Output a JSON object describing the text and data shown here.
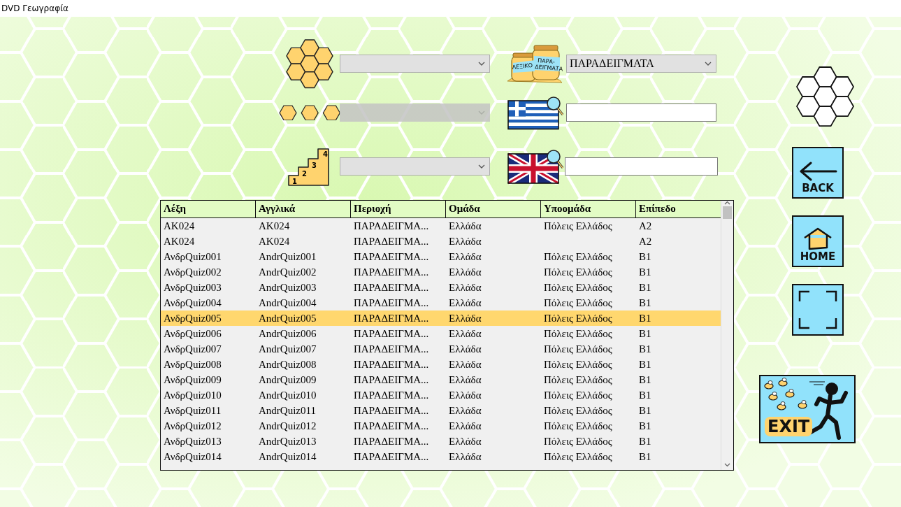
{
  "window": {
    "title": "DVD Γεωγραφία"
  },
  "left_filters": [
    {
      "kind": "groups",
      "disabled": false
    },
    {
      "kind": "subgroups",
      "disabled": true
    },
    {
      "kind": "levels",
      "disabled": false,
      "steps": [
        "1",
        "2",
        "3",
        "4"
      ]
    }
  ],
  "right_filters": [
    {
      "kind": "dictionary",
      "value": "ΠΑΡΑΔΕΙΓΜΑΤΑ",
      "jar_labels": [
        "ΛΕΞΙΚΟ",
        "ΠΑΡΑ-",
        "ΔΕΙΓΜΑΤΑ"
      ]
    },
    {
      "kind": "greek"
    },
    {
      "kind": "english"
    }
  ],
  "table": {
    "columns": [
      "Λέξη",
      "Αγγλικά",
      "Περιοχή",
      "Ομάδα",
      "Υποομάδα",
      "Επίπεδο"
    ],
    "rows": [
      {
        "selected": false,
        "cells": [
          "AK024",
          "AK024",
          "ΠΑΡΑΔΕΙΓΜΑ...",
          "Ελλάδα",
          "Πόλεις Ελλάδος",
          "A2"
        ]
      },
      {
        "selected": false,
        "cells": [
          "AK024",
          "AK024",
          "ΠΑΡΑΔΕΙΓΜΑ...",
          "Ελλάδα",
          null,
          "A2"
        ]
      },
      {
        "selected": false,
        "cells": [
          "ΑνδρQuiz001",
          "AndrQuiz001",
          "ΠΑΡΑΔΕΙΓΜΑ...",
          "Ελλάδα",
          "Πόλεις Ελλάδος",
          "B1"
        ]
      },
      {
        "selected": false,
        "cells": [
          "ΑνδρQuiz002",
          "AndrQuiz002",
          "ΠΑΡΑΔΕΙΓΜΑ...",
          "Ελλάδα",
          "Πόλεις Ελλάδος",
          "B1"
        ]
      },
      {
        "selected": false,
        "cells": [
          "ΑνδρQuiz003",
          "AndrQuiz003",
          "ΠΑΡΑΔΕΙΓΜΑ...",
          "Ελλάδα",
          "Πόλεις Ελλάδος",
          "B1"
        ]
      },
      {
        "selected": false,
        "cells": [
          "ΑνδρQuiz004",
          "AndrQuiz004",
          "ΠΑΡΑΔΕΙΓΜΑ...",
          "Ελλάδα",
          "Πόλεις Ελλάδος",
          "B1"
        ]
      },
      {
        "selected": true,
        "cells": [
          "ΑνδρQuiz005",
          "AndrQuiz005",
          "ΠΑΡΑΔΕΙΓΜΑ...",
          "Ελλάδα",
          "Πόλεις Ελλάδος",
          "B1"
        ]
      },
      {
        "selected": false,
        "cells": [
          "ΑνδρQuiz006",
          "AndrQuiz006",
          "ΠΑΡΑΔΕΙΓΜΑ...",
          "Ελλάδα",
          "Πόλεις Ελλάδος",
          "B1"
        ]
      },
      {
        "selected": false,
        "cells": [
          "ΑνδρQuiz007",
          "AndrQuiz007",
          "ΠΑΡΑΔΕΙΓΜΑ...",
          "Ελλάδα",
          "Πόλεις Ελλάδος",
          "B1"
        ]
      },
      {
        "selected": false,
        "cells": [
          "ΑνδρQuiz008",
          "AndrQuiz008",
          "ΠΑΡΑΔΕΙΓΜΑ...",
          "Ελλάδα",
          "Πόλεις Ελλάδος",
          "B1"
        ]
      },
      {
        "selected": false,
        "cells": [
          "ΑνδρQuiz009",
          "AndrQuiz009",
          "ΠΑΡΑΔΕΙΓΜΑ...",
          "Ελλάδα",
          "Πόλεις Ελλάδος",
          "B1"
        ]
      },
      {
        "selected": false,
        "cells": [
          "ΑνδρQuiz010",
          "AndrQuiz010",
          "ΠΑΡΑΔΕΙΓΜΑ...",
          "Ελλάδα",
          "Πόλεις Ελλάδος",
          "B1"
        ]
      },
      {
        "selected": false,
        "cells": [
          "ΑνδρQuiz011",
          "AndrQuiz011",
          "ΠΑΡΑΔΕΙΓΜΑ...",
          "Ελλάδα",
          "Πόλεις Ελλάδος",
          "B1"
        ]
      },
      {
        "selected": false,
        "cells": [
          "ΑνδρQuiz012",
          "AndrQuiz012",
          "ΠΑΡΑΔΕΙΓΜΑ...",
          "Ελλάδα",
          "Πόλεις Ελλάδος",
          "B1"
        ]
      },
      {
        "selected": false,
        "cells": [
          "ΑνδρQuiz013",
          "AndrQuiz013",
          "ΠΑΡΑΔΕΙΓΜΑ...",
          "Ελλάδα",
          "Πόλεις Ελλάδος",
          "B1"
        ]
      },
      {
        "selected": false,
        "cells": [
          "ΑνδρQuiz014",
          "AndrQuiz014",
          "ΠΑΡΑΔΕΙΓΜΑ...",
          "Ελλάδα",
          "Πόλεις Ελλάδος",
          "B1"
        ]
      }
    ]
  },
  "nav_buttons": [
    {
      "kind": "menu"
    },
    {
      "kind": "back",
      "label": "BACK"
    },
    {
      "kind": "home",
      "label": "HOME"
    },
    {
      "kind": "fullscreen"
    },
    {
      "kind": "exit",
      "label": "EXIT"
    }
  ]
}
